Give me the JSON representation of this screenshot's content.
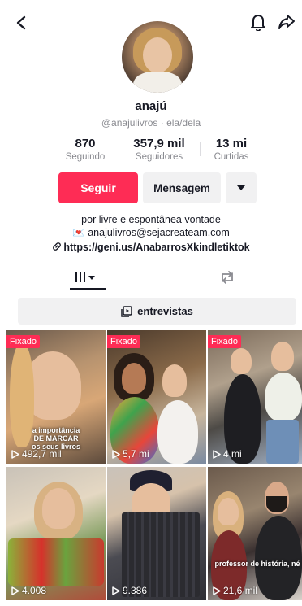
{
  "header": {
    "back_icon": "chevron-left-icon",
    "bell_icon": "bell-icon",
    "share_icon": "share-arrow-icon"
  },
  "profile": {
    "name": "anajú",
    "handle": "@anajulivros · ela/dela",
    "stats": {
      "following_count": "870",
      "following_label": "Seguindo",
      "followers_count": "357,9 mil",
      "followers_label": "Seguidores",
      "likes_count": "13 mi",
      "likes_label": "Curtidas"
    },
    "actions": {
      "follow_label": "Seguir",
      "message_label": "Mensagem",
      "more_icon": "caret-down-icon"
    },
    "bio": {
      "line1": "por livre e espontânea vontade",
      "line2": "💌 anajulivros@sejacreateam.com",
      "link": "https://geni.us/AnabarrosXkindletiktok"
    }
  },
  "tabs": {
    "videos_icon": "grid-icon",
    "reposts_icon": "repost-icon"
  },
  "playlist": {
    "label": "entrevistas",
    "icon": "playlist-icon"
  },
  "grid": {
    "pinned_label": "Fixado",
    "items": [
      {
        "pinned": true,
        "views": "492,7 mil",
        "caption": "a importância\nDE MARCAR\nos seus livros"
      },
      {
        "pinned": true,
        "views": "5,7 mi",
        "caption": ""
      },
      {
        "pinned": true,
        "views": "4 mi",
        "caption": ""
      },
      {
        "pinned": false,
        "views": "4.008",
        "caption": ""
      },
      {
        "pinned": false,
        "views": "9.386",
        "caption": ""
      },
      {
        "pinned": false,
        "views": "21,6 mil",
        "caption": "professor de história, né"
      }
    ]
  },
  "colors": {
    "accent": "#fe2c55",
    "text": "#161823",
    "muted": "#8a8b91",
    "button_secondary": "#f1f1f2"
  }
}
